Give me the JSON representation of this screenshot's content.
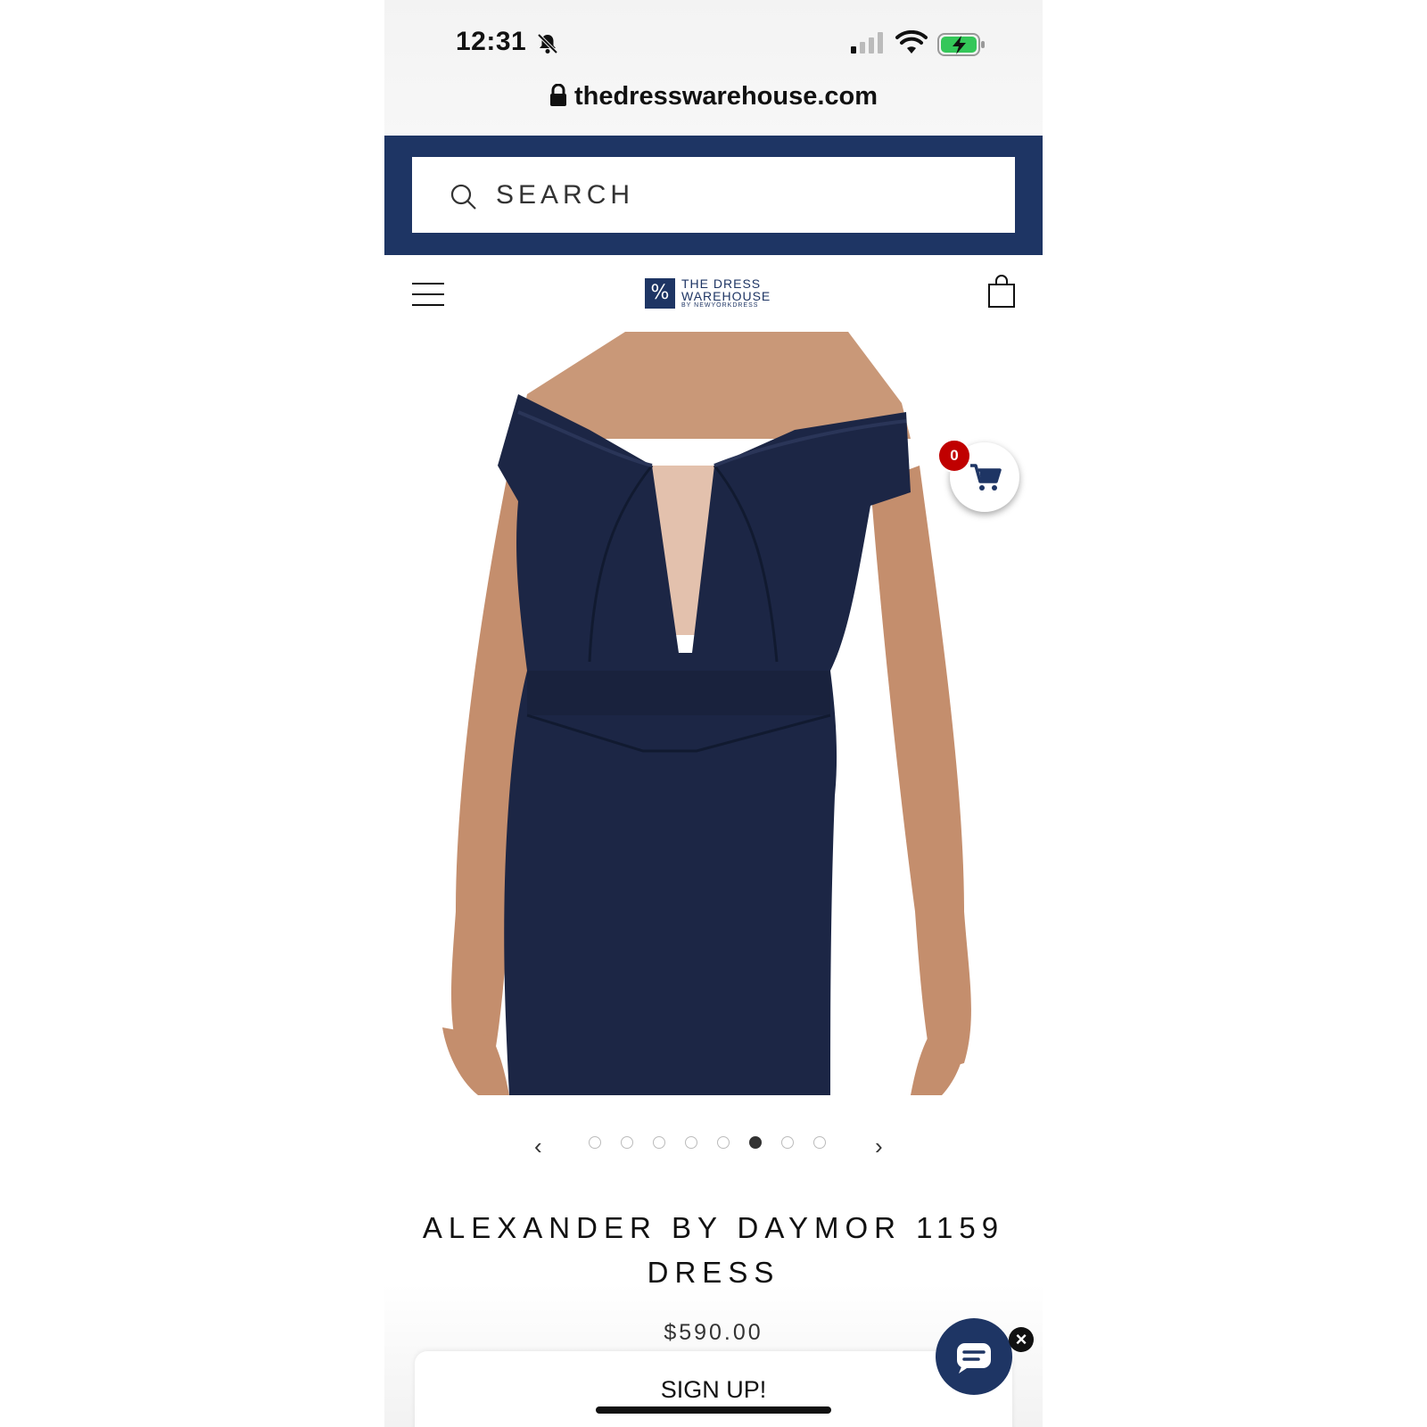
{
  "status_bar": {
    "time": "12:31",
    "url": "thedresswarehouse.com"
  },
  "search": {
    "placeholder": "SEARCH"
  },
  "brand": {
    "logo_mark": "%",
    "line1": "THE DRESS",
    "line2": "WAREHOUSE",
    "line3": "BY NEWYORKDRESS"
  },
  "cart": {
    "count": "0"
  },
  "carousel": {
    "prev": "‹",
    "next": "›",
    "total": 8,
    "active_index": 5
  },
  "product": {
    "title": "ALEXANDER BY DAYMOR 1159 DRESS",
    "price": "$590.00"
  },
  "signup": {
    "label": "SIGN UP!"
  },
  "chat": {
    "close": "×"
  },
  "colors": {
    "brand_navy": "#1e3564",
    "dress_navy": "#1c2645",
    "badge_red": "#c00000",
    "battery_green": "#34c759"
  }
}
